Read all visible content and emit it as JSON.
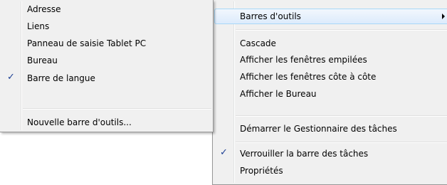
{
  "submenu": {
    "items": [
      {
        "label": "Adresse"
      },
      {
        "label": "Liens"
      },
      {
        "label": "Panneau de saisie Tablet PC"
      },
      {
        "label": "Bureau"
      },
      {
        "label": "Barre de langue",
        "check": "✓"
      },
      {
        "label": "Nouvelle barre d'outils..."
      }
    ]
  },
  "mainmenu": {
    "items": [
      {
        "label": "Barres d'outils"
      },
      {
        "label": "Cascade"
      },
      {
        "label": "Afficher les fenêtres empilées"
      },
      {
        "label": "Afficher les fenêtres côte à côte"
      },
      {
        "label": "Afficher le Bureau"
      },
      {
        "label": "Démarrer le Gestionnaire des tâches"
      },
      {
        "label": "Verrouiller la barre des tâches",
        "check": "✓"
      },
      {
        "label": "Propriétés"
      }
    ]
  }
}
